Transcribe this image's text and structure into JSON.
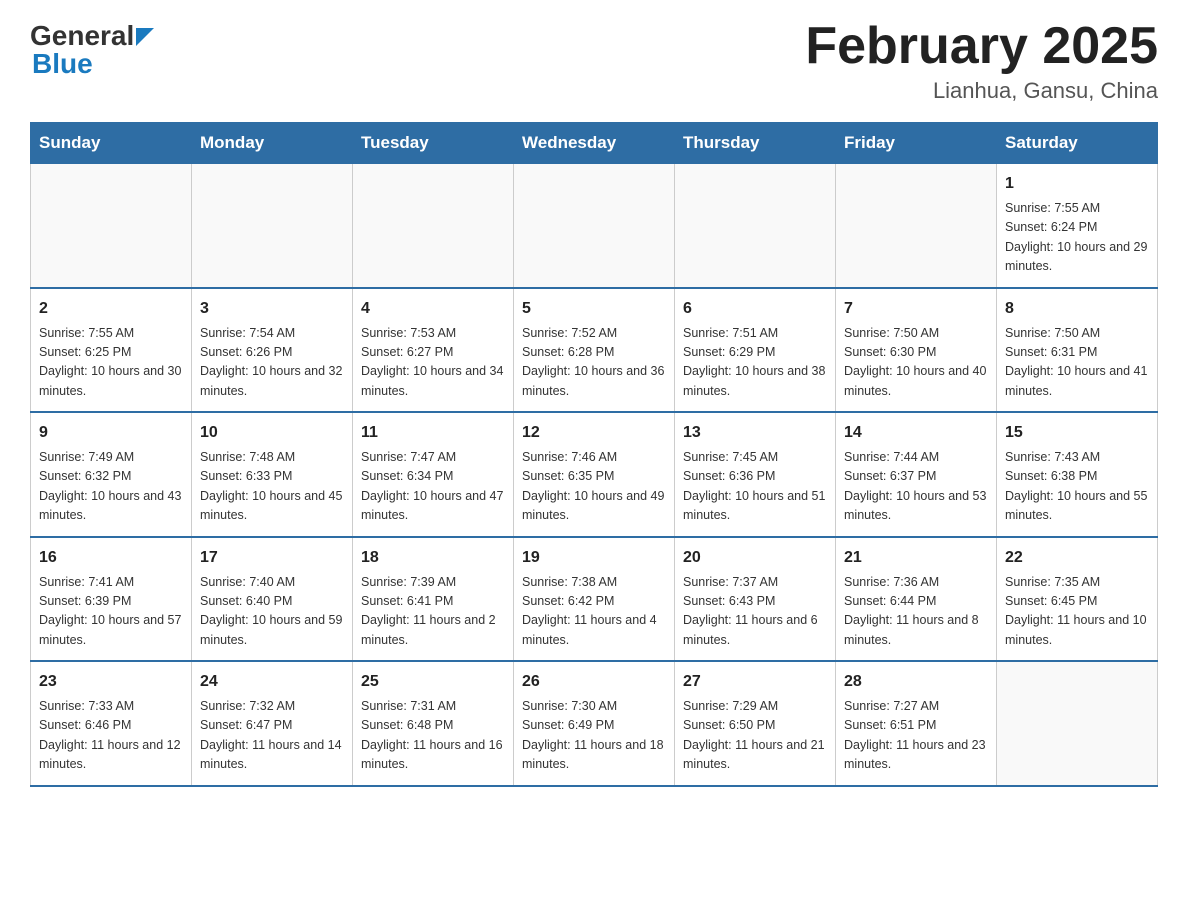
{
  "header": {
    "logo_general": "General",
    "logo_blue": "Blue",
    "month_title": "February 2025",
    "location": "Lianhua, Gansu, China"
  },
  "days_of_week": [
    "Sunday",
    "Monday",
    "Tuesday",
    "Wednesday",
    "Thursday",
    "Friday",
    "Saturday"
  ],
  "weeks": [
    [
      {
        "day": "",
        "info": ""
      },
      {
        "day": "",
        "info": ""
      },
      {
        "day": "",
        "info": ""
      },
      {
        "day": "",
        "info": ""
      },
      {
        "day": "",
        "info": ""
      },
      {
        "day": "",
        "info": ""
      },
      {
        "day": "1",
        "info": "Sunrise: 7:55 AM\nSunset: 6:24 PM\nDaylight: 10 hours and 29 minutes."
      }
    ],
    [
      {
        "day": "2",
        "info": "Sunrise: 7:55 AM\nSunset: 6:25 PM\nDaylight: 10 hours and 30 minutes."
      },
      {
        "day": "3",
        "info": "Sunrise: 7:54 AM\nSunset: 6:26 PM\nDaylight: 10 hours and 32 minutes."
      },
      {
        "day": "4",
        "info": "Sunrise: 7:53 AM\nSunset: 6:27 PM\nDaylight: 10 hours and 34 minutes."
      },
      {
        "day": "5",
        "info": "Sunrise: 7:52 AM\nSunset: 6:28 PM\nDaylight: 10 hours and 36 minutes."
      },
      {
        "day": "6",
        "info": "Sunrise: 7:51 AM\nSunset: 6:29 PM\nDaylight: 10 hours and 38 minutes."
      },
      {
        "day": "7",
        "info": "Sunrise: 7:50 AM\nSunset: 6:30 PM\nDaylight: 10 hours and 40 minutes."
      },
      {
        "day": "8",
        "info": "Sunrise: 7:50 AM\nSunset: 6:31 PM\nDaylight: 10 hours and 41 minutes."
      }
    ],
    [
      {
        "day": "9",
        "info": "Sunrise: 7:49 AM\nSunset: 6:32 PM\nDaylight: 10 hours and 43 minutes."
      },
      {
        "day": "10",
        "info": "Sunrise: 7:48 AM\nSunset: 6:33 PM\nDaylight: 10 hours and 45 minutes."
      },
      {
        "day": "11",
        "info": "Sunrise: 7:47 AM\nSunset: 6:34 PM\nDaylight: 10 hours and 47 minutes."
      },
      {
        "day": "12",
        "info": "Sunrise: 7:46 AM\nSunset: 6:35 PM\nDaylight: 10 hours and 49 minutes."
      },
      {
        "day": "13",
        "info": "Sunrise: 7:45 AM\nSunset: 6:36 PM\nDaylight: 10 hours and 51 minutes."
      },
      {
        "day": "14",
        "info": "Sunrise: 7:44 AM\nSunset: 6:37 PM\nDaylight: 10 hours and 53 minutes."
      },
      {
        "day": "15",
        "info": "Sunrise: 7:43 AM\nSunset: 6:38 PM\nDaylight: 10 hours and 55 minutes."
      }
    ],
    [
      {
        "day": "16",
        "info": "Sunrise: 7:41 AM\nSunset: 6:39 PM\nDaylight: 10 hours and 57 minutes."
      },
      {
        "day": "17",
        "info": "Sunrise: 7:40 AM\nSunset: 6:40 PM\nDaylight: 10 hours and 59 minutes."
      },
      {
        "day": "18",
        "info": "Sunrise: 7:39 AM\nSunset: 6:41 PM\nDaylight: 11 hours and 2 minutes."
      },
      {
        "day": "19",
        "info": "Sunrise: 7:38 AM\nSunset: 6:42 PM\nDaylight: 11 hours and 4 minutes."
      },
      {
        "day": "20",
        "info": "Sunrise: 7:37 AM\nSunset: 6:43 PM\nDaylight: 11 hours and 6 minutes."
      },
      {
        "day": "21",
        "info": "Sunrise: 7:36 AM\nSunset: 6:44 PM\nDaylight: 11 hours and 8 minutes."
      },
      {
        "day": "22",
        "info": "Sunrise: 7:35 AM\nSunset: 6:45 PM\nDaylight: 11 hours and 10 minutes."
      }
    ],
    [
      {
        "day": "23",
        "info": "Sunrise: 7:33 AM\nSunset: 6:46 PM\nDaylight: 11 hours and 12 minutes."
      },
      {
        "day": "24",
        "info": "Sunrise: 7:32 AM\nSunset: 6:47 PM\nDaylight: 11 hours and 14 minutes."
      },
      {
        "day": "25",
        "info": "Sunrise: 7:31 AM\nSunset: 6:48 PM\nDaylight: 11 hours and 16 minutes."
      },
      {
        "day": "26",
        "info": "Sunrise: 7:30 AM\nSunset: 6:49 PM\nDaylight: 11 hours and 18 minutes."
      },
      {
        "day": "27",
        "info": "Sunrise: 7:29 AM\nSunset: 6:50 PM\nDaylight: 11 hours and 21 minutes."
      },
      {
        "day": "28",
        "info": "Sunrise: 7:27 AM\nSunset: 6:51 PM\nDaylight: 11 hours and 23 minutes."
      },
      {
        "day": "",
        "info": ""
      }
    ]
  ]
}
